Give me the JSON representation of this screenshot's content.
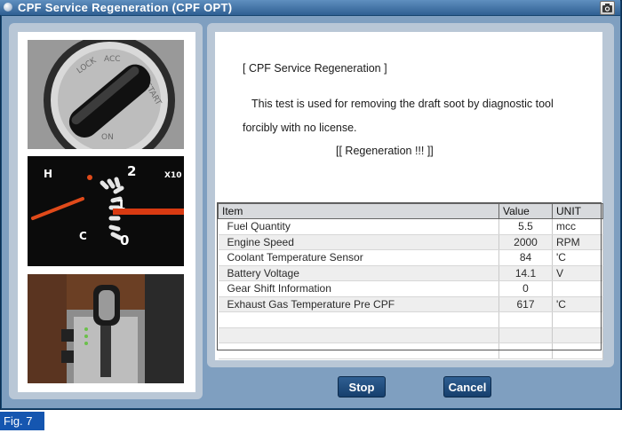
{
  "window": {
    "title": "CPF Service Regeneration (CPF OPT)"
  },
  "description": {
    "heading": "[ CPF Service Regeneration ]",
    "line1": "This test is used for removing the draft soot by diagnostic tool",
    "line2": "forcibly with no license.",
    "action": "[[ Regeneration !!! ]]"
  },
  "table": {
    "headers": {
      "item": "Item",
      "value": "Value",
      "unit": "UNIT"
    },
    "rows": [
      {
        "item": "Fuel Quantity",
        "value": "5.5",
        "unit": "mcc"
      },
      {
        "item": "Engine Speed",
        "value": "2000",
        "unit": "RPM"
      },
      {
        "item": "Coolant Temperature Sensor",
        "value": "84",
        "unit": "'C"
      },
      {
        "item": "Battery Voltage",
        "value": "14.1",
        "unit": "V"
      },
      {
        "item": "Gear Shift Information",
        "value": "0",
        "unit": ""
      },
      {
        "item": "Exhaust Gas Temperature Pre CPF",
        "value": "617",
        "unit": "'C"
      },
      {
        "item": "",
        "value": "",
        "unit": ""
      },
      {
        "item": "",
        "value": "",
        "unit": ""
      },
      {
        "item": "",
        "value": "",
        "unit": ""
      }
    ]
  },
  "buttons": {
    "stop": "Stop",
    "cancel": "Cancel"
  },
  "figure_label": "Fig. 7",
  "photos": {
    "ignition": {
      "labels": [
        "LOCK",
        "ACC",
        "START",
        "ON"
      ]
    },
    "gauge": {
      "labels": [
        "H",
        "C",
        "2",
        "1",
        "0",
        "X10"
      ]
    }
  },
  "icons": [
    "window-dot-icon",
    "camera-icon"
  ],
  "colors": {
    "titlebar": "#2f5f92",
    "panel": "#7f9fc0",
    "button": "#163f6d",
    "fig_label": "#1556b0"
  }
}
